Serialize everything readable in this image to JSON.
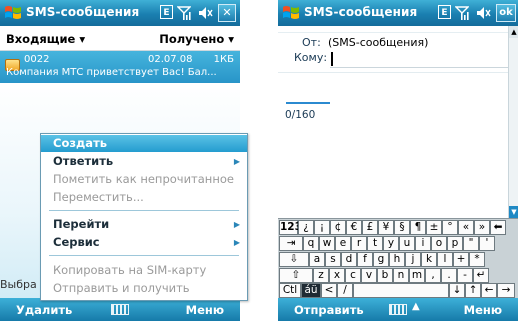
{
  "colors": {
    "titlebar": "#1a7fb0",
    "selection": "#249ccf",
    "softbar": "#167aa9",
    "menu_text": "#1c2e3a",
    "disabled": "#9a9a9a"
  },
  "left": {
    "title": "SMS-сообщения",
    "tray": {
      "e_label": "E",
      "close_label": "✕"
    },
    "folder_header": "Входящие ▾",
    "sort_header": "Получено ▾",
    "message": {
      "number": "0022",
      "date": "02.07.08",
      "size": "1КБ",
      "preview": "Компания МТС приветствует Вас! Бал..."
    },
    "select_label": "Выбра",
    "menu": {
      "create": "Создать",
      "reply": "Ответить",
      "mark_unread": "Пометить как непрочитанное",
      "move": "Переместить...",
      "goto": "Перейти",
      "service": "Сервис",
      "copy_sim": "Копировать на SIM-карту",
      "send_receive": "Отправить и получить"
    },
    "softkeys": {
      "left": "Удалить",
      "right": "Меню"
    }
  },
  "right": {
    "title": "SMS-сообщения",
    "tray": {
      "e_label": "E",
      "ok_label": "ok"
    },
    "from_label": "От:",
    "from_value": "(SMS-сообщения)",
    "to_label": "Кому:",
    "to_value": "",
    "counter": "0/160",
    "keyboard": {
      "row1": [
        "123",
        "¿",
        "¡",
        "¢",
        "€",
        "£",
        "¥",
        "§",
        "¶",
        "±",
        "°",
        "«",
        "»",
        "⬅"
      ],
      "row2": [
        "⇥",
        "q",
        "w",
        "e",
        "r",
        "t",
        "y",
        "u",
        "i",
        "o",
        "p",
        "\"",
        "'"
      ],
      "row3": [
        "⇩",
        "a",
        "s",
        "d",
        "f",
        "g",
        "h",
        "j",
        "k",
        "l",
        "+",
        "*"
      ],
      "row4": [
        "⇧",
        "z",
        "x",
        "c",
        "v",
        "b",
        "n",
        "m",
        ",",
        ".",
        "-",
        "↵"
      ],
      "row5": [
        "Ctl",
        "áü",
        "<",
        "/",
        "↓",
        "↑",
        "←",
        "→"
      ]
    },
    "softkeys": {
      "left": "Отправить",
      "right": "Меню"
    }
  }
}
